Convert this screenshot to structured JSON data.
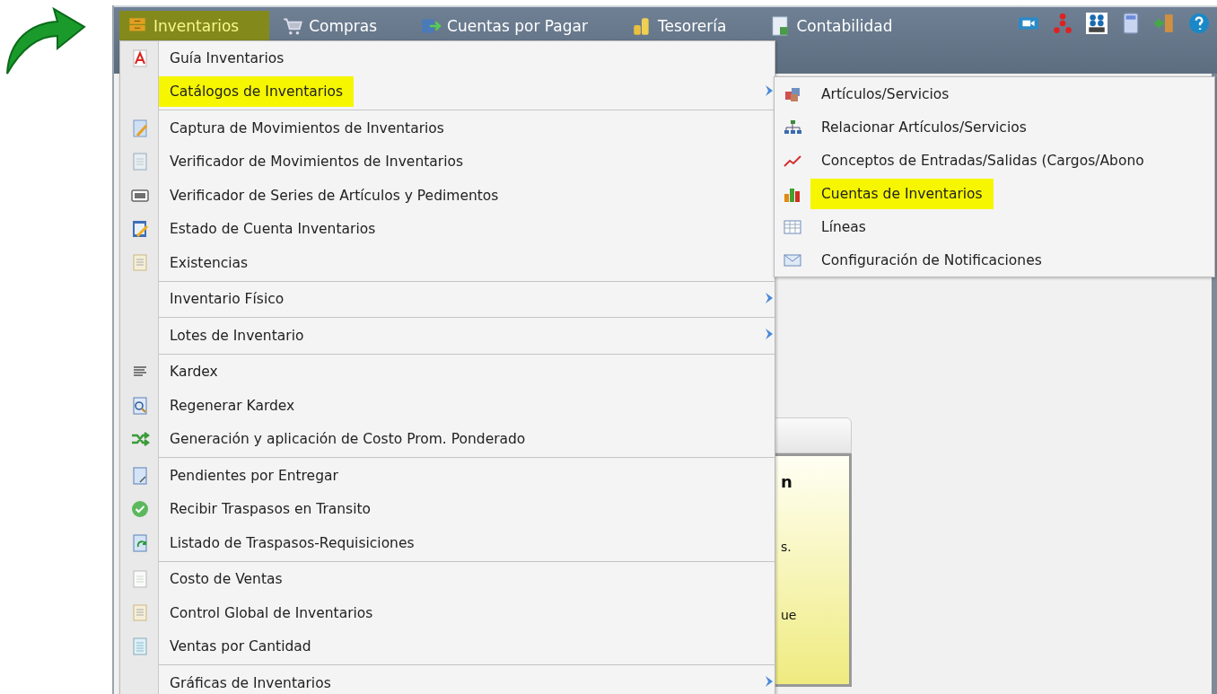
{
  "menubar": {
    "items": [
      {
        "label": "Inventarios",
        "selected": true
      },
      {
        "label": "Compras",
        "selected": false
      },
      {
        "label": "Cuentas por Pagar",
        "selected": false
      },
      {
        "label": "Tesorería",
        "selected": false
      },
      {
        "label": "Contabilidad",
        "selected": false
      }
    ]
  },
  "menu": {
    "sections": [
      {
        "items": [
          {
            "label": "Guía Inventarios",
            "submenu": false,
            "highlighted": false
          },
          {
            "label": "Catálogos de Inventarios",
            "submenu": true,
            "highlighted": true
          }
        ]
      },
      {
        "items": [
          {
            "label": "Captura de Movimientos de Inventarios",
            "submenu": false,
            "highlighted": false
          },
          {
            "label": "Verificador de Movimientos de Inventarios",
            "submenu": false,
            "highlighted": false
          },
          {
            "label": "Verificador de Series de Artículos y Pedimentos",
            "submenu": false,
            "highlighted": false
          },
          {
            "label": "Estado de Cuenta Inventarios",
            "submenu": false,
            "highlighted": false
          },
          {
            "label": "Existencias",
            "submenu": false,
            "highlighted": false
          }
        ]
      },
      {
        "items": [
          {
            "label": "Inventario Físico",
            "submenu": true,
            "highlighted": false
          }
        ]
      },
      {
        "items": [
          {
            "label": "Lotes de Inventario",
            "submenu": true,
            "highlighted": false
          }
        ]
      },
      {
        "items": [
          {
            "label": "Kardex",
            "submenu": false,
            "highlighted": false
          },
          {
            "label": "Regenerar Kardex",
            "submenu": false,
            "highlighted": false
          },
          {
            "label": "Generación y aplicación de Costo Prom. Ponderado",
            "submenu": false,
            "highlighted": false
          }
        ]
      },
      {
        "items": [
          {
            "label": "Pendientes por Entregar",
            "submenu": false,
            "highlighted": false
          },
          {
            "label": "Recibir Traspasos en Transito",
            "submenu": false,
            "highlighted": false
          },
          {
            "label": "Listado de Traspasos-Requisiciones",
            "submenu": false,
            "highlighted": false
          }
        ]
      },
      {
        "items": [
          {
            "label": "Costo de Ventas",
            "submenu": false,
            "highlighted": false
          },
          {
            "label": "Control Global de Inventarios",
            "submenu": false,
            "highlighted": false
          },
          {
            "label": "Ventas por Cantidad",
            "submenu": false,
            "highlighted": false
          }
        ]
      },
      {
        "items": [
          {
            "label": "Gráficas de Inventarios",
            "submenu": true,
            "highlighted": false
          }
        ]
      }
    ]
  },
  "submenu": {
    "items": [
      {
        "label": "Artículos/Servicios",
        "highlighted": false
      },
      {
        "label": "Relacionar Artículos/Servicios",
        "highlighted": false
      },
      {
        "label": "Conceptos de Entradas/Salidas (Cargos/Abono",
        "highlighted": false
      },
      {
        "label": "Cuentas de Inventarios",
        "highlighted": true
      },
      {
        "label": "Líneas",
        "highlighted": false
      },
      {
        "label": "Configuración de Notificaciones",
        "highlighted": false
      }
    ]
  },
  "background_card": {
    "title": "n",
    "lines": [
      "s.",
      "ue"
    ]
  }
}
